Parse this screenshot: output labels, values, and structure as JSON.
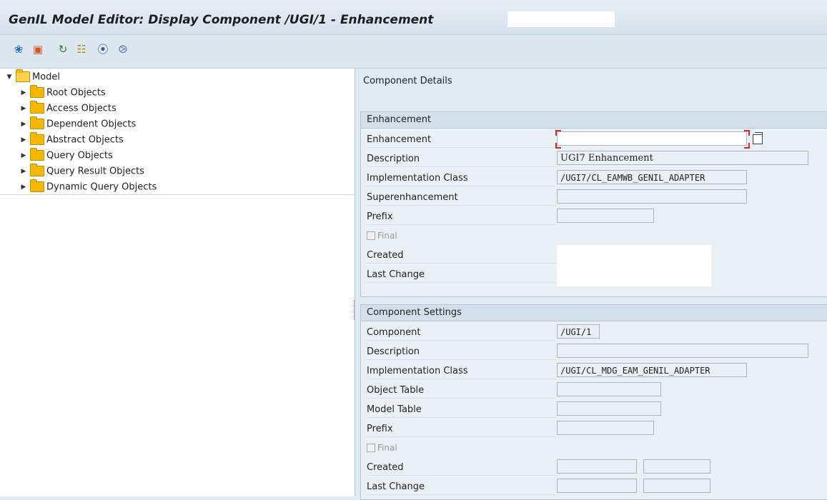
{
  "window": {
    "title": "GenIL Model Editor: Display Component  /UGI/1 - Enhancement"
  },
  "toolbar": {
    "icons": [
      "other-object-icon",
      "transport-icon",
      "refresh-icon",
      "where-used-icon",
      "find-icon",
      "find-next-icon"
    ]
  },
  "tree": {
    "root_label": "Model",
    "items": [
      {
        "label": "Root Objects"
      },
      {
        "label": "Access Objects"
      },
      {
        "label": "Dependent Objects"
      },
      {
        "label": "Abstract Objects"
      },
      {
        "label": "Query Objects"
      },
      {
        "label": "Query Result Objects"
      },
      {
        "label": "Dynamic Query Objects"
      }
    ]
  },
  "details": {
    "title": "Component Details",
    "enhancement_group": {
      "header": "Enhancement",
      "labels": {
        "enhancement": "Enhancement",
        "description": "Description",
        "impl_class": "Implementation Class",
        "superenhancement": "Superenhancement",
        "prefix": "Prefix",
        "final": "Final",
        "created": "Created",
        "last_change": "Last Change"
      },
      "values": {
        "enhancement": "",
        "description": "UGI7 Enhancement",
        "impl_class": "/UGI7/CL_EAMWB_GENIL_ADAPTER",
        "superenhancement": "",
        "prefix": ""
      }
    },
    "settings_group": {
      "header": "Component Settings",
      "labels": {
        "component": "Component",
        "description": "Description",
        "impl_class": "Implementation Class",
        "object_table": "Object Table",
        "model_table": "Model Table",
        "prefix": "Prefix",
        "final": "Final",
        "created": "Created",
        "last_change": "Last Change"
      },
      "values": {
        "component": "/UGI/1",
        "description": "",
        "impl_class": "/UGI/CL_MDG_EAM_GENIL_ADAPTER",
        "object_table": "",
        "model_table": "",
        "prefix": ""
      }
    }
  }
}
